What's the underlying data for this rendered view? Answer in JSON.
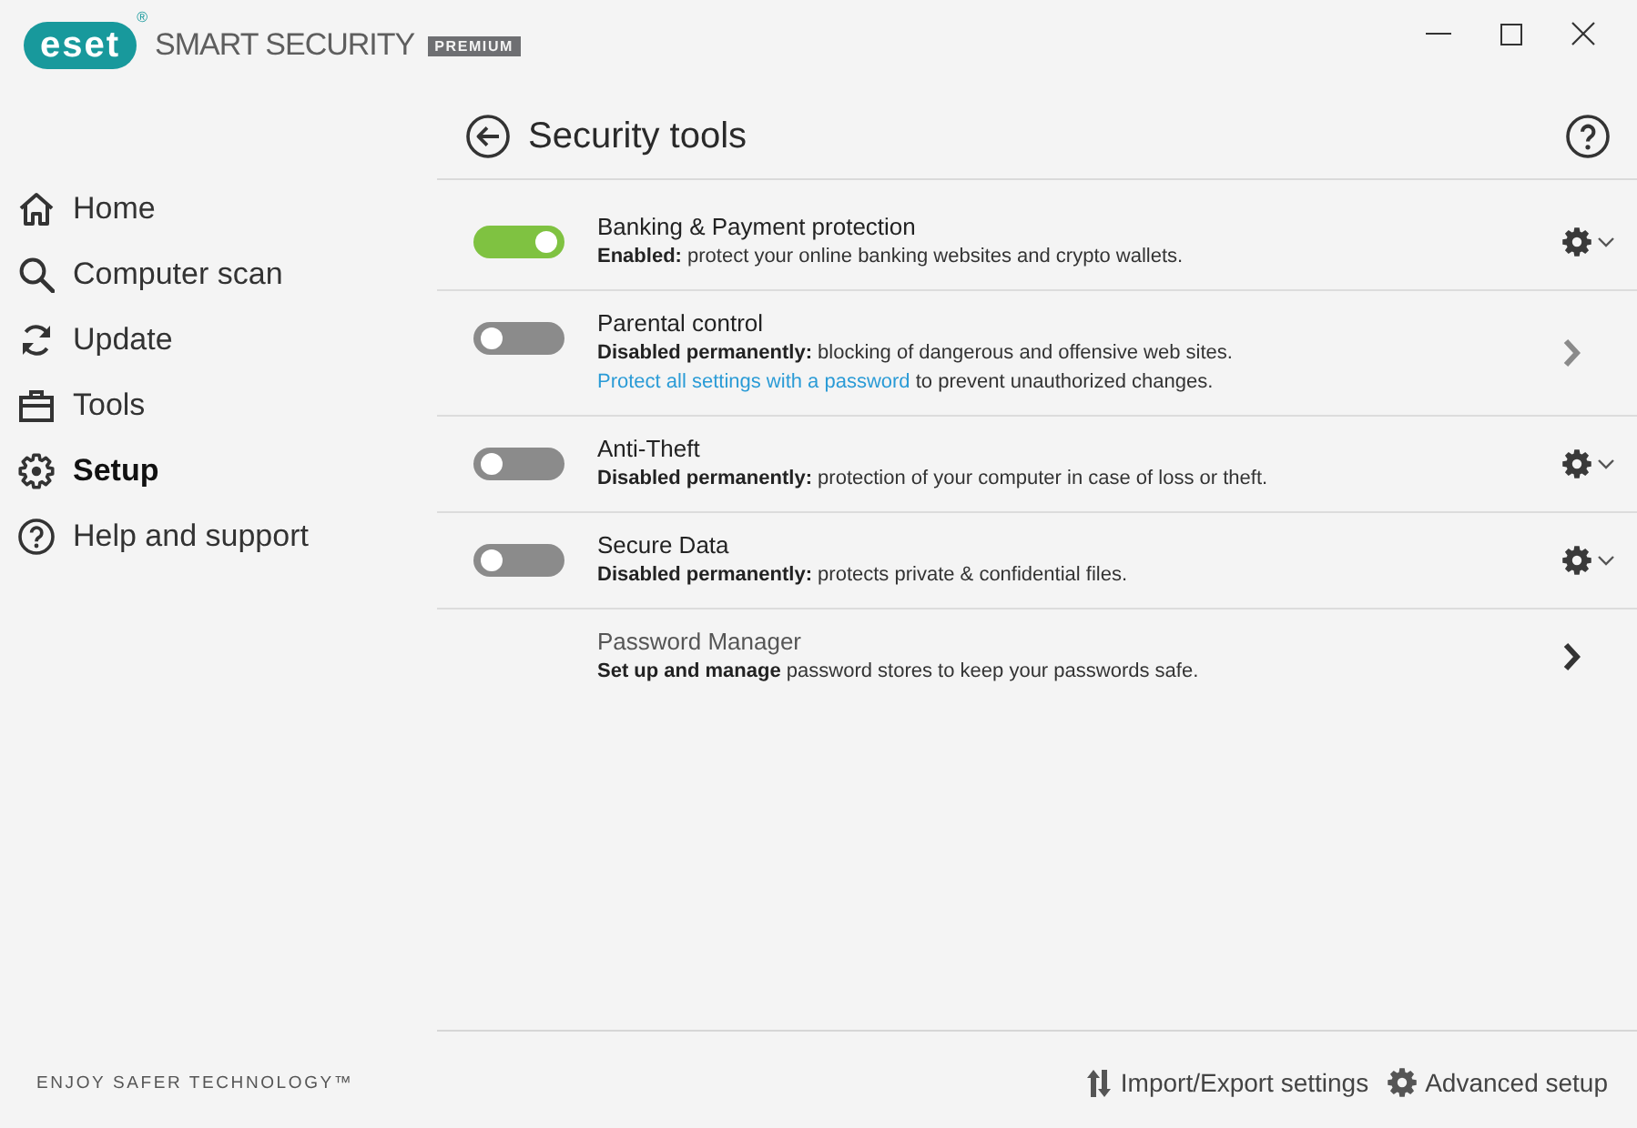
{
  "window": {
    "logo": "eset",
    "registered_mark": "®",
    "product": "SMART SECURITY",
    "edition": "PREMIUM"
  },
  "sidebar": {
    "items": [
      {
        "label": "Home",
        "selected": false
      },
      {
        "label": "Computer scan",
        "selected": false
      },
      {
        "label": "Update",
        "selected": false
      },
      {
        "label": "Tools",
        "selected": false
      },
      {
        "label": "Setup",
        "selected": true
      },
      {
        "label": "Help and support",
        "selected": false
      }
    ],
    "tagline": "ENJOY SAFER TECHNOLOGY™"
  },
  "page": {
    "title": "Security tools"
  },
  "tools": [
    {
      "kind": "toggle",
      "on": true,
      "title": "Banking & Payment protection",
      "description": "**Enabled:** protect your online banking websites and crypto wallets.",
      "settings_menu": true
    },
    {
      "kind": "toggle",
      "on": false,
      "title": "Parental control",
      "description": "**Disabled permanently:** blocking of dangerous and offensive web sites.",
      "note": {
        "link": "Protect all settings with a password",
        "text": "to prevent unauthorized changes."
      },
      "settings_menu": false
    },
    {
      "kind": "toggle",
      "on": false,
      "title": "Anti-Theft",
      "description": "**Disabled permanently:** protection of your computer in case of loss or theft.",
      "settings_menu": true
    },
    {
      "kind": "toggle",
      "on": false,
      "title": "Secure Data",
      "description": "**Disabled permanently:** protects private & confidential files.",
      "settings_menu": true
    },
    {
      "kind": "plain",
      "title": "Password Manager",
      "description": "**Set up and manage** password stores to keep your passwords safe.",
      "settings_menu": false
    }
  ],
  "footer": {
    "actions": [
      {
        "label": "Import/Export settings"
      },
      {
        "label": "Advanced setup"
      }
    ]
  }
}
